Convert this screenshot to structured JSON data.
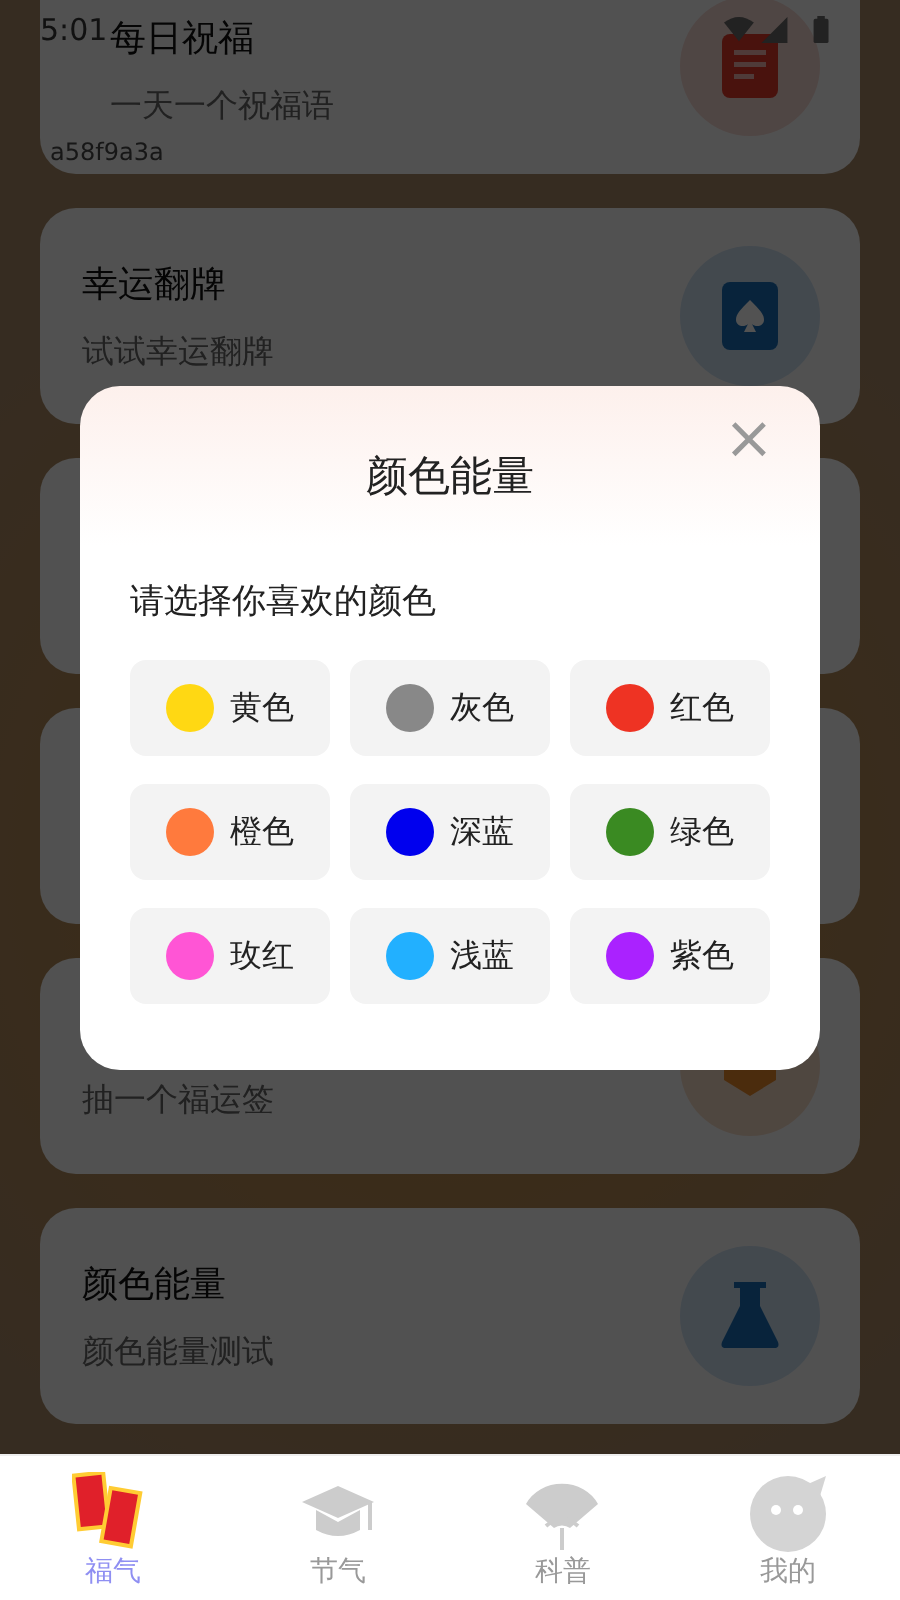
{
  "status_bar": {
    "time": "5:01"
  },
  "cards": [
    {
      "title": "每日祝福",
      "subtitle": "一天一个祝福语",
      "tag": "a58f9a3a",
      "kind": "note"
    },
    {
      "title": "幸运翻牌",
      "subtitle": "试试幸运翻牌",
      "kind": "spade"
    },
    {
      "subtitle": "抽一个福运签",
      "kind": "lot"
    },
    {
      "title": "颜色能量",
      "subtitle": "颜色能量测试",
      "kind": "flask"
    }
  ],
  "dialog": {
    "title": "颜色能量",
    "close": "×",
    "prompt": "请选择你喜欢的颜色",
    "colors": [
      {
        "label": "黄色",
        "color": "#ffd813"
      },
      {
        "label": "灰色",
        "color": "#888888"
      },
      {
        "label": "红色",
        "color": "#ee3323"
      },
      {
        "label": "橙色",
        "color": "#ff7a3d"
      },
      {
        "label": "深蓝",
        "color": "#0000ee"
      },
      {
        "label": "绿色",
        "color": "#3a8a22"
      },
      {
        "label": "玫红",
        "color": "#ff55d5"
      },
      {
        "label": "浅蓝",
        "color": "#22b0ff"
      },
      {
        "label": "紫色",
        "color": "#aa22ff"
      }
    ]
  },
  "tabs": [
    {
      "label": "福气",
      "kind": "envelopes",
      "selected": true
    },
    {
      "label": "节气",
      "kind": "cap",
      "selected": false
    },
    {
      "label": "科普",
      "kind": "fan",
      "selected": false
    },
    {
      "label": "我的",
      "kind": "face",
      "selected": false
    }
  ]
}
